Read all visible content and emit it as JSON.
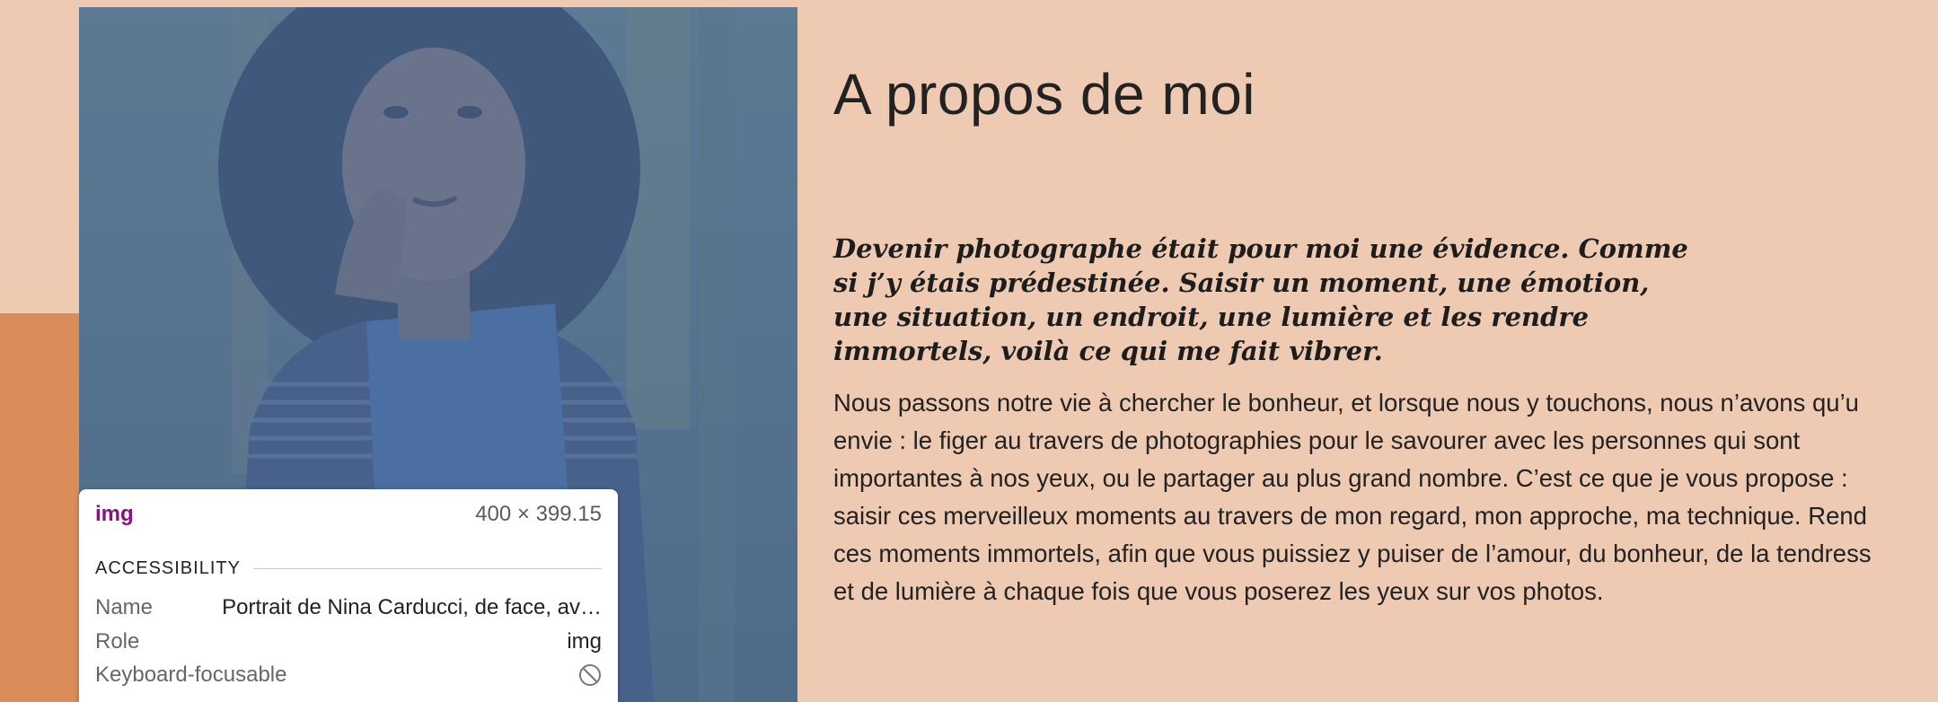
{
  "section": {
    "title": "A propos de moi",
    "lead": "Devenir photographe était pour moi une évidence. Comme si j’y étais prédestinée. Saisir un moment, une émotion, une situation, un endroit, une lumière et les rendre immortels, voilà ce qui me fait vibrer.",
    "body": "Nous passons notre vie à chercher le bonheur, et lorsque nous y touchons, nous n’avons qu’u\nenvie : le figer au travers de photographies pour le savourer avec les personnes qui sont\nimportantes à nos yeux, ou le partager au plus grand nombre. C’est ce que je vous propose :\nsaisir ces merveilleux moments au travers de mon regard, mon approche, ma technique. Rend\nces moments immortels, afin que vous puissiez y puiser de l’amour, du bonheur, de la tendress\net de lumière à chaque fois que vous poserez les yeux sur vos photos."
  },
  "photo": {
    "name": "Portrait de Nina Carducci, de face, av…"
  },
  "inspector": {
    "tag": "img",
    "dimensions": "400 × 399.15",
    "section_label": "ACCESSIBILITY",
    "rows": [
      {
        "key": "Name",
        "value": "Portrait de Nina Carducci, de face, av…"
      },
      {
        "key": "Role",
        "value": "img"
      },
      {
        "key": "Keyboard-focusable",
        "icon": "not-allowed-icon"
      }
    ]
  },
  "colors": {
    "page_background": "#efcab2",
    "accent_band": "#da8c5b",
    "highlight_overlay": "#5d87c4",
    "tag_color": "#881280"
  }
}
